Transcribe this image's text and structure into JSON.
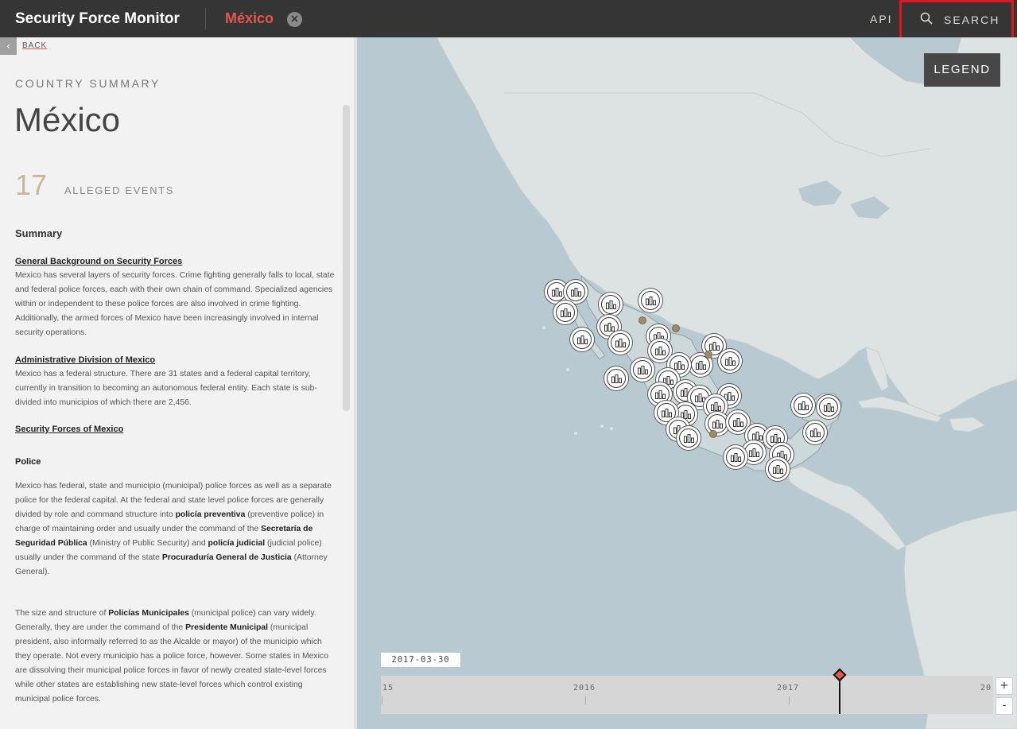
{
  "header": {
    "site_title": "Security Force Monitor",
    "country": "México",
    "close_glyph": "×",
    "api_label": "API",
    "search_label": "SEARCH",
    "search_icon": "search-icon"
  },
  "sidebar": {
    "back_arrow": "‹",
    "back_label": "BACK",
    "eyebrow": "COUNTRY SUMMARY",
    "country_name": "México",
    "event_count": "17",
    "event_label": "ALLEGED EVENTS",
    "summary_heading": "Summary",
    "sections": [
      {
        "title": "General Background on Security Forces",
        "text": "Mexico has several layers of security forces. Crime fighting generally falls to local, state and federal police forces, each with their own chain of command. Specialized agencies within or independent to these police forces are also involved in crime fighting. Additionally, the armed forces of Mexico have been increasingly involved in internal security operations."
      },
      {
        "title": "Administrative Division of Mexico",
        "text": "Mexico has a federal structure. There are 31 states and a federal capital territory, currently in transition to becoming an autonomous federal entity. Each state is sub-divided into municipios of which there are 2,456."
      },
      {
        "title": "Security Forces of Mexico",
        "text": ""
      }
    ],
    "police_heading": "Police",
    "police_p1": {
      "a": "Mexico has federal, state and municipio (municipal) police forces as well as a separate police for the federal capital. At the federal and state level police forces are generally divided by role and command structure into ",
      "b": "policía preventiva",
      "c": " (preventive police) in charge of maintaining order and usually under the command of the ",
      "d": "Secretaría de Seguridad Pública",
      "e": " (Ministry of Public Security) and ",
      "f": "policía judicial",
      "g": " (judicial police) usually under the command of the state ",
      "h": "Procuraduría General de Justicia",
      "i": " (Attorney General)."
    },
    "police_p2": {
      "a": "The size and structure of ",
      "b": "Policías Municipales",
      "c": " (municipal police) can vary widely. Generally, they are under the command of the ",
      "d": "Presidente Municipal",
      "e": " (municipal president, also informally referred to as the Alcalde or mayor) of the municipio which they operate. Not every municipio has a police force, however. Some states in Mexico are dissolving their municipal police forces in favor of newly created state-level forces while other states are establishing new state-level forces which control existing municipal police forces."
    }
  },
  "map": {
    "legend_label": "LEGEND",
    "colors": {
      "water": "#b9c9d1",
      "land": "#dde3e2",
      "mexico": "#cdd8da",
      "marker_ring": "#333333",
      "dot": "#9c8a6a"
    }
  },
  "timeline": {
    "current_date": "2017-03-30",
    "ticks": [
      "15",
      "2016",
      "2017",
      "20"
    ],
    "zoom_in": "+",
    "zoom_out": "-"
  }
}
